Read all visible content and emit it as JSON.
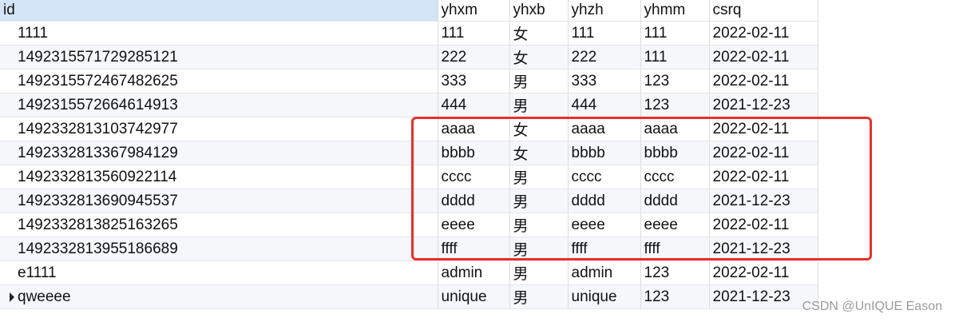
{
  "columns": [
    "id",
    "yhxm",
    "yhxb",
    "yhzh",
    "yhmm",
    "csrq"
  ],
  "rows": [
    [
      "1111",
      "111",
      "女",
      "111",
      "111",
      "2022-02-11"
    ],
    [
      "1492315571729285121",
      "222",
      "女",
      "222",
      "111",
      "2022-02-11"
    ],
    [
      "1492315572467482625",
      "333",
      "男",
      "333",
      "123",
      "2022-02-11"
    ],
    [
      "1492315572664614913",
      "444",
      "男",
      "444",
      "123",
      "2021-12-23"
    ],
    [
      "1492332813103742977",
      "aaaa",
      "女",
      "aaaa",
      "aaaa",
      "2022-02-11"
    ],
    [
      "1492332813367984129",
      "bbbb",
      "女",
      "bbbb",
      "bbbb",
      "2022-02-11"
    ],
    [
      "1492332813560922114",
      "cccc",
      "男",
      "cccc",
      "cccc",
      "2022-02-11"
    ],
    [
      "1492332813690945537",
      "dddd",
      "男",
      "dddd",
      "dddd",
      "2021-12-23"
    ],
    [
      "1492332813825163265",
      "eeee",
      "男",
      "eeee",
      "eeee",
      "2022-02-11"
    ],
    [
      "1492332813955186689",
      "ffff",
      "男",
      "ffff",
      "ffff",
      "2021-12-23"
    ],
    [
      "e1111",
      "admin",
      "男",
      "admin",
      "123",
      "2022-02-11"
    ],
    [
      "qweeee",
      "unique",
      "男",
      "unique",
      "123",
      "2021-12-23"
    ]
  ],
  "colors": {
    "selected_header": "#d3e5f7",
    "annotation": "#e8302b"
  },
  "current_row_index": 11,
  "watermark": "CSDN @UnIQUE Eason"
}
